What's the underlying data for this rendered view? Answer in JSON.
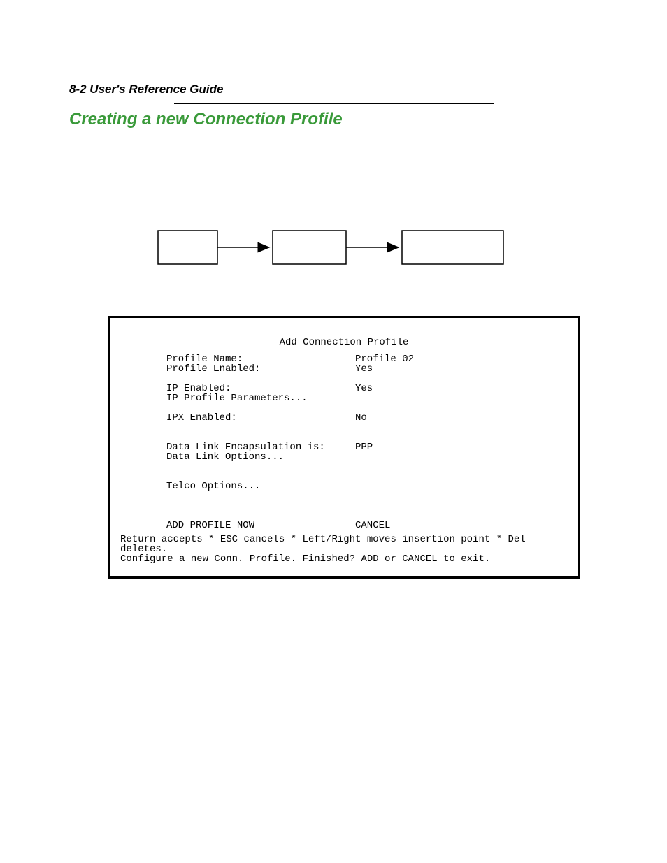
{
  "header": {
    "page_ref": "8-2  User's Reference Guide",
    "section_title": "Creating a new Connection Profile"
  },
  "terminal": {
    "title": "Add Connection Profile",
    "profile_name_label": "Profile Name:",
    "profile_name_value": "Profile 02",
    "profile_enabled_label": "Profile Enabled:",
    "profile_enabled_value": "Yes",
    "ip_enabled_label": "IP Enabled:",
    "ip_enabled_value": "Yes",
    "ip_profile_params_label": "IP Profile Parameters...",
    "ipx_enabled_label": "IPX Enabled:",
    "ipx_enabled_value": "No",
    "datalink_encap_label": "Data Link Encapsulation is:",
    "datalink_encap_value": "PPP",
    "datalink_options_label": "Data Link Options...",
    "telco_options_label": "Telco Options...",
    "add_profile_label": "ADD PROFILE NOW",
    "cancel_label": "CANCEL",
    "footer_line1": "Return accepts * ESC cancels * Left/Right moves insertion point * Del deletes.",
    "footer_line2": "Configure a new Conn. Profile. Finished?  ADD or CANCEL to exit."
  }
}
